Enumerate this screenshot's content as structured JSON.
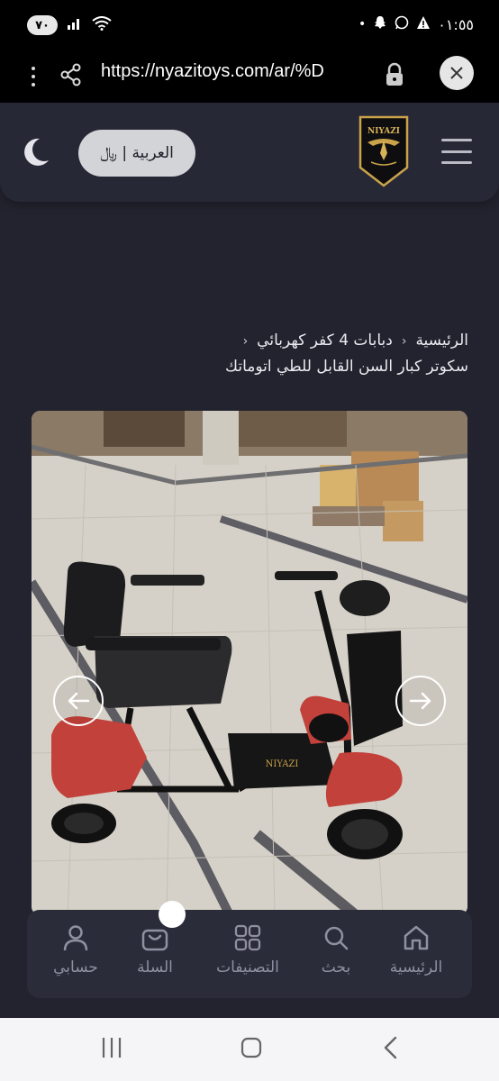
{
  "status_bar": {
    "battery": "٧٠",
    "time": "٠١:٥٥"
  },
  "browser": {
    "url": "https://nyazitoys.com/ar/%D"
  },
  "header": {
    "logo_text": "NIYAZI",
    "language_button": "العربية | ﷼"
  },
  "breadcrumb": {
    "home": "الرئيسية",
    "category": "دبابات 4 كفر كهربائي",
    "current": "سكوتر كبار السن القابل للطي اتوماتك"
  },
  "bottom_nav": {
    "items": [
      {
        "label": "الرئيسية",
        "icon": "home-icon"
      },
      {
        "label": "بحث",
        "icon": "search-icon"
      },
      {
        "label": "التصنيفات",
        "icon": "categories-icon"
      },
      {
        "label": "السلة",
        "icon": "cart-icon"
      },
      {
        "label": "حسابي",
        "icon": "user-icon"
      }
    ]
  },
  "colors": {
    "page_bg": "#22232e",
    "header_bg": "#272836",
    "nav_bg": "#2b2c3a",
    "scooter_red": "#c2413a"
  }
}
